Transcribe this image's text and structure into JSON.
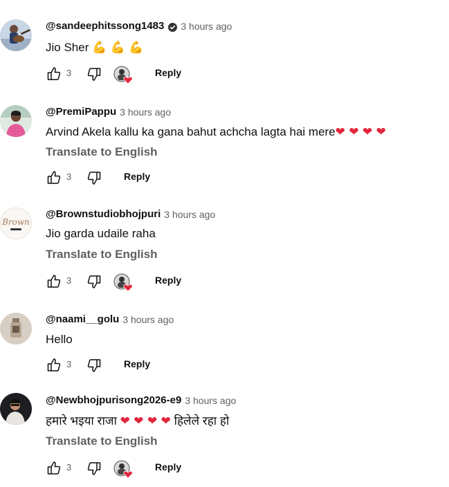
{
  "comments": [
    {
      "handle": "@sandeephitssong1483",
      "verified": true,
      "time": "3 hours ago",
      "text": "Jio Sher ",
      "emoji": "💪 💪 💪",
      "translate": "",
      "likes": "3",
      "reply": "Reply",
      "creator_heart": true,
      "avatar_icon": "guitarist-avatar"
    },
    {
      "handle": "@PremiPappu",
      "verified": false,
      "time": "3 hours ago",
      "text": "Arvind Akela kallu ka gana bahut achcha lagta hai mere",
      "emoji": "❤ ❤ ❤ ❤",
      "translate": "Translate to English",
      "likes": "3",
      "reply": "Reply",
      "creator_heart": false,
      "avatar_icon": "person-pink-shirt-avatar"
    },
    {
      "handle": "@Brownstudiobhojpuri",
      "verified": false,
      "time": "3 hours ago",
      "text": "Jio garda udaile raha",
      "emoji": "",
      "translate": "Translate to English",
      "likes": "3",
      "reply": "Reply",
      "creator_heart": true,
      "avatar_icon": "brown-studio-logo-avatar",
      "avatar_logo_text": "Brown"
    },
    {
      "handle": "@naami__golu",
      "verified": false,
      "time": "3 hours ago",
      "text": "Hello",
      "emoji": "",
      "translate": "",
      "likes": "3",
      "reply": "Reply",
      "creator_heart": false,
      "avatar_icon": "bottle-photo-avatar"
    },
    {
      "handle": "@Newbhojpurisong2026-e9",
      "verified": false,
      "time": "3 hours ago",
      "text": "हमारे भइया राजा ",
      "emoji": "❤ ❤ ❤ ❤",
      "text_after": " हिलेले रहा हो",
      "translate": "Translate to English",
      "likes": "3",
      "reply": "Reply",
      "creator_heart": true,
      "avatar_icon": "man-photo-avatar"
    }
  ],
  "colors": {
    "text": "#0f0f0f",
    "secondary": "#606060",
    "heart": "#e2263b"
  }
}
